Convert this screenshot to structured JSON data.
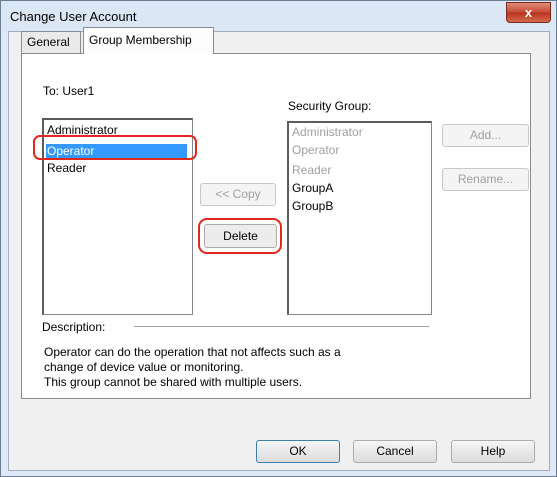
{
  "window": {
    "title": "Change User Account",
    "close_glyph": "x"
  },
  "tabs": [
    {
      "label": "General",
      "active": false
    },
    {
      "label": "Group Membership",
      "active": true
    }
  ],
  "to_label": "To: User1",
  "user_groups": [
    "Administrator",
    "Operator",
    "Reader"
  ],
  "selected_user_group": "Operator",
  "security_group_label": "Security Group:",
  "security_groups": [
    {
      "label": "Administrator",
      "enabled": false
    },
    {
      "label": "Operator",
      "enabled": false
    },
    {
      "label": "Reader",
      "enabled": false
    },
    {
      "label": "GroupA",
      "enabled": true
    },
    {
      "label": "GroupB",
      "enabled": true
    }
  ],
  "buttons": {
    "copy": "<< Copy",
    "delete": "Delete",
    "add": "Add...",
    "rename": "Rename...",
    "ok": "OK",
    "cancel": "Cancel",
    "help": "Help"
  },
  "description": {
    "label": "Description:",
    "lines": [
      "Operator can do the operation that not affects such as a",
      "change of device value or monitoring.",
      "This group cannot be shared with multiple users."
    ]
  },
  "highlight_color": "#e0281f",
  "selection_color": "#3399ff"
}
